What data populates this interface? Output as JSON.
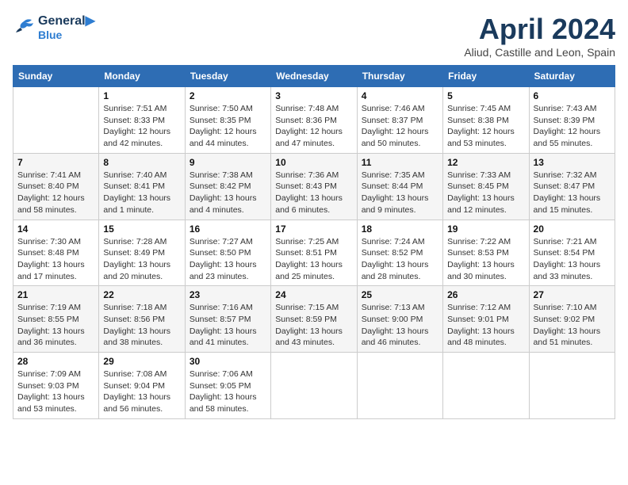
{
  "header": {
    "logo_line1": "General",
    "logo_line2": "Blue",
    "title": "April 2024",
    "subtitle": "Aliud, Castille and Leon, Spain"
  },
  "weekdays": [
    "Sunday",
    "Monday",
    "Tuesday",
    "Wednesday",
    "Thursday",
    "Friday",
    "Saturday"
  ],
  "weeks": [
    [
      {
        "day": "",
        "info": ""
      },
      {
        "day": "1",
        "info": "Sunrise: 7:51 AM\nSunset: 8:33 PM\nDaylight: 12 hours\nand 42 minutes."
      },
      {
        "day": "2",
        "info": "Sunrise: 7:50 AM\nSunset: 8:35 PM\nDaylight: 12 hours\nand 44 minutes."
      },
      {
        "day": "3",
        "info": "Sunrise: 7:48 AM\nSunset: 8:36 PM\nDaylight: 12 hours\nand 47 minutes."
      },
      {
        "day": "4",
        "info": "Sunrise: 7:46 AM\nSunset: 8:37 PM\nDaylight: 12 hours\nand 50 minutes."
      },
      {
        "day": "5",
        "info": "Sunrise: 7:45 AM\nSunset: 8:38 PM\nDaylight: 12 hours\nand 53 minutes."
      },
      {
        "day": "6",
        "info": "Sunrise: 7:43 AM\nSunset: 8:39 PM\nDaylight: 12 hours\nand 55 minutes."
      }
    ],
    [
      {
        "day": "7",
        "info": "Sunrise: 7:41 AM\nSunset: 8:40 PM\nDaylight: 12 hours\nand 58 minutes."
      },
      {
        "day": "8",
        "info": "Sunrise: 7:40 AM\nSunset: 8:41 PM\nDaylight: 13 hours\nand 1 minute."
      },
      {
        "day": "9",
        "info": "Sunrise: 7:38 AM\nSunset: 8:42 PM\nDaylight: 13 hours\nand 4 minutes."
      },
      {
        "day": "10",
        "info": "Sunrise: 7:36 AM\nSunset: 8:43 PM\nDaylight: 13 hours\nand 6 minutes."
      },
      {
        "day": "11",
        "info": "Sunrise: 7:35 AM\nSunset: 8:44 PM\nDaylight: 13 hours\nand 9 minutes."
      },
      {
        "day": "12",
        "info": "Sunrise: 7:33 AM\nSunset: 8:45 PM\nDaylight: 13 hours\nand 12 minutes."
      },
      {
        "day": "13",
        "info": "Sunrise: 7:32 AM\nSunset: 8:47 PM\nDaylight: 13 hours\nand 15 minutes."
      }
    ],
    [
      {
        "day": "14",
        "info": "Sunrise: 7:30 AM\nSunset: 8:48 PM\nDaylight: 13 hours\nand 17 minutes."
      },
      {
        "day": "15",
        "info": "Sunrise: 7:28 AM\nSunset: 8:49 PM\nDaylight: 13 hours\nand 20 minutes."
      },
      {
        "day": "16",
        "info": "Sunrise: 7:27 AM\nSunset: 8:50 PM\nDaylight: 13 hours\nand 23 minutes."
      },
      {
        "day": "17",
        "info": "Sunrise: 7:25 AM\nSunset: 8:51 PM\nDaylight: 13 hours\nand 25 minutes."
      },
      {
        "day": "18",
        "info": "Sunrise: 7:24 AM\nSunset: 8:52 PM\nDaylight: 13 hours\nand 28 minutes."
      },
      {
        "day": "19",
        "info": "Sunrise: 7:22 AM\nSunset: 8:53 PM\nDaylight: 13 hours\nand 30 minutes."
      },
      {
        "day": "20",
        "info": "Sunrise: 7:21 AM\nSunset: 8:54 PM\nDaylight: 13 hours\nand 33 minutes."
      }
    ],
    [
      {
        "day": "21",
        "info": "Sunrise: 7:19 AM\nSunset: 8:55 PM\nDaylight: 13 hours\nand 36 minutes."
      },
      {
        "day": "22",
        "info": "Sunrise: 7:18 AM\nSunset: 8:56 PM\nDaylight: 13 hours\nand 38 minutes."
      },
      {
        "day": "23",
        "info": "Sunrise: 7:16 AM\nSunset: 8:57 PM\nDaylight: 13 hours\nand 41 minutes."
      },
      {
        "day": "24",
        "info": "Sunrise: 7:15 AM\nSunset: 8:59 PM\nDaylight: 13 hours\nand 43 minutes."
      },
      {
        "day": "25",
        "info": "Sunrise: 7:13 AM\nSunset: 9:00 PM\nDaylight: 13 hours\nand 46 minutes."
      },
      {
        "day": "26",
        "info": "Sunrise: 7:12 AM\nSunset: 9:01 PM\nDaylight: 13 hours\nand 48 minutes."
      },
      {
        "day": "27",
        "info": "Sunrise: 7:10 AM\nSunset: 9:02 PM\nDaylight: 13 hours\nand 51 minutes."
      }
    ],
    [
      {
        "day": "28",
        "info": "Sunrise: 7:09 AM\nSunset: 9:03 PM\nDaylight: 13 hours\nand 53 minutes."
      },
      {
        "day": "29",
        "info": "Sunrise: 7:08 AM\nSunset: 9:04 PM\nDaylight: 13 hours\nand 56 minutes."
      },
      {
        "day": "30",
        "info": "Sunrise: 7:06 AM\nSunset: 9:05 PM\nDaylight: 13 hours\nand 58 minutes."
      },
      {
        "day": "",
        "info": ""
      },
      {
        "day": "",
        "info": ""
      },
      {
        "day": "",
        "info": ""
      },
      {
        "day": "",
        "info": ""
      }
    ]
  ]
}
